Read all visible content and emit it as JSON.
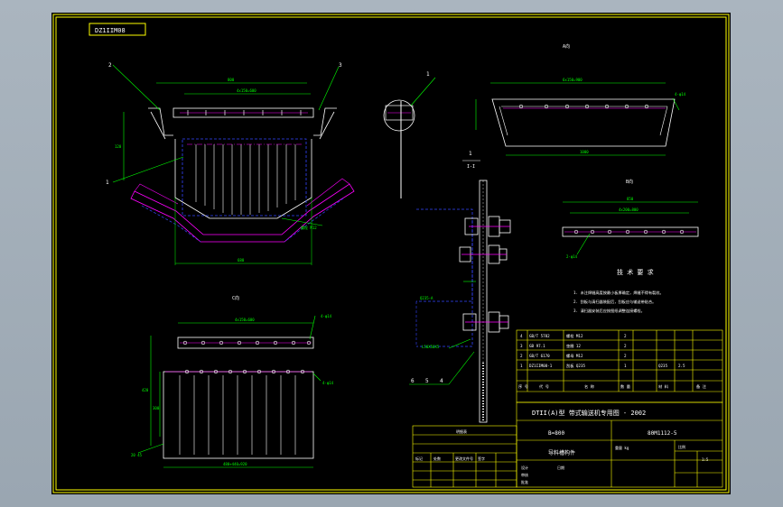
{
  "drawing_number_tag": "DZ1IIM08",
  "view_labels": {
    "top_right": "A向",
    "mid_right": "B向",
    "bottom_left": "C向",
    "section": "I-I"
  },
  "balloons": [
    "1",
    "2",
    "3",
    "4",
    "5",
    "6",
    "1"
  ],
  "dimensions": {
    "top_overall": "800",
    "top_inner": "4x150=600",
    "left_small": "120",
    "bottom_width": "680",
    "bottom_view_top": "4x150=600",
    "bottom_view_bottom": "480+440=920",
    "bottom_view_left": "420",
    "bottom_view_left2": "300",
    "a_view_top": "6x150=900",
    "a_view_bottom": "1000",
    "b_view_top": "4x200=800",
    "b_view_total": "850"
  },
  "annotations": {
    "bolt_note": "螺栓 M12",
    "hole_note": "2-φ14",
    "label_top_right": "4-φ14",
    "c_left": "20 45",
    "c_right": "4-φ14",
    "section_note1": "Q235-A",
    "section_note2": "L50X50X5"
  },
  "tech_requirements": {
    "title": "技 术 要 求",
    "items": [
      "1. 未注焊缝高度按最小板厚确定，焊缝不得有裂纹。",
      "2. 刮板与清扫器装配后，刮板应与输送带贴合。",
      "3. 清扫器安装后应按图纸调整连接螺栓。"
    ]
  },
  "bom_header": {
    "no": "序 号",
    "code": "代 号",
    "name": "名 称",
    "qty": "数 量",
    "material": "材 料",
    "remark": "备 注"
  },
  "bom_rows": [
    [
      "4",
      "GB/T 5782",
      "螺栓 M12",
      "2",
      "",
      ""
    ],
    [
      "3",
      "GB 97.1",
      "垫圈 12",
      "2",
      "",
      ""
    ],
    [
      "2",
      "GB/T 6170",
      "螺母 M12",
      "2",
      "",
      ""
    ],
    [
      "1",
      "DZ1IIM08-1",
      "刮板 Q235",
      "1",
      "Q235",
      "2.5"
    ]
  ],
  "title_block": {
    "company_line": "DTII(A)型 带式输送机专用图 - 2002",
    "belt_width": "B=800",
    "drawing_code": "80M1112-5",
    "part_name": "导料槽构件",
    "weight_label": "重量 kg",
    "scale_label": "比例",
    "sheet": "1:5",
    "designer_label": "设计",
    "checker_label": "审核",
    "approver_label": "批准",
    "date_label": "日期",
    "revision_label": "标记",
    "count_label": "处数",
    "file_label": "更改文件号",
    "sign_label": "签字"
  },
  "revision_table_title": "明细表",
  "colors": {
    "border": "#ffff00",
    "outline": "#ffffff",
    "dimension": "#00ff00",
    "hidden": "#3344ff",
    "center": "#ff00ff",
    "leader": "#00ff00",
    "text": "#ffffff",
    "table": "#ffff00"
  }
}
